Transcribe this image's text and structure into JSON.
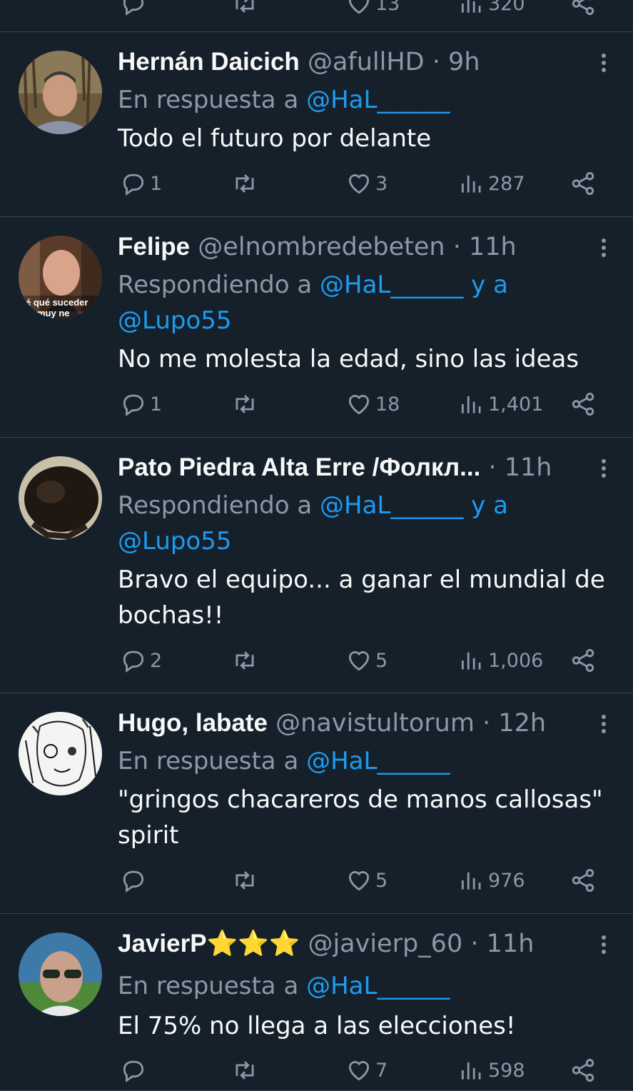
{
  "top_actions": {
    "replies": "",
    "likes": "13",
    "views": "320"
  },
  "tweets": [
    {
      "name": "Hernán Daicich",
      "handle": "@afullHD",
      "time": "9h",
      "reply_prefix": "En respuesta a",
      "reply_to": "@HaL______",
      "reply_join": "",
      "reply_to2": "",
      "text": "Todo el futuro por delante",
      "replies": "1",
      "likes": "3",
      "views": "287",
      "avatar": "man-portrait-forest"
    },
    {
      "name": "Felipe",
      "handle": "@elnombredebeten",
      "time": "11h",
      "reply_prefix": "Respondiendo a",
      "reply_to": "@HaL______",
      "reply_join": "y a",
      "reply_to2": "@Lupo55",
      "text": "No me molesta la edad, sino las ideas",
      "replies": "1",
      "likes": "18",
      "views": "1,401",
      "avatar": "bald-man-meme",
      "avatar_caption_1": "é qué suceder",
      "avatar_caption_2": "muy ne"
    },
    {
      "name": "Pato Piedra Alta Erre /Фолкл...",
      "handle": "",
      "time": "11h",
      "reply_prefix": "Respondiendo a",
      "reply_to": "@HaL______",
      "reply_join": "y a",
      "reply_to2": "@Lupo55",
      "text": "Bravo el equipo... a  ganar el mundial de bochas!!",
      "replies": "2",
      "likes": "5",
      "views": "1,006",
      "avatar": "dark-animal"
    },
    {
      "name": "Hugo, labate",
      "handle": "@navistultorum",
      "time": "12h",
      "reply_prefix": "En respuesta a",
      "reply_to": "@HaL______",
      "reply_join": "",
      "reply_to2": "",
      "text": "\"gringos chacareros de manos callosas\" spirit",
      "replies": "",
      "likes": "5",
      "views": "976",
      "avatar": "sketch-face"
    },
    {
      "name": "JavierP⭐⭐⭐",
      "handle": "@javierp_60",
      "time": "11h",
      "reply_prefix": "En respuesta a",
      "reply_to": "@HaL______",
      "reply_join": "",
      "reply_to2": "",
      "text": "El 75% no llega a las elecciones!",
      "replies": "",
      "likes": "7",
      "views": "598",
      "avatar": "man-sunglasses"
    }
  ],
  "icons": {
    "reply": "reply-icon",
    "retweet": "retweet-icon",
    "like": "heart-icon",
    "views": "views-icon",
    "share": "share-icon",
    "more": "more-icon"
  },
  "colors": {
    "background": "#15202b",
    "link": "#1d9bf0",
    "muted": "#8b98a5",
    "divider": "#38444d"
  }
}
